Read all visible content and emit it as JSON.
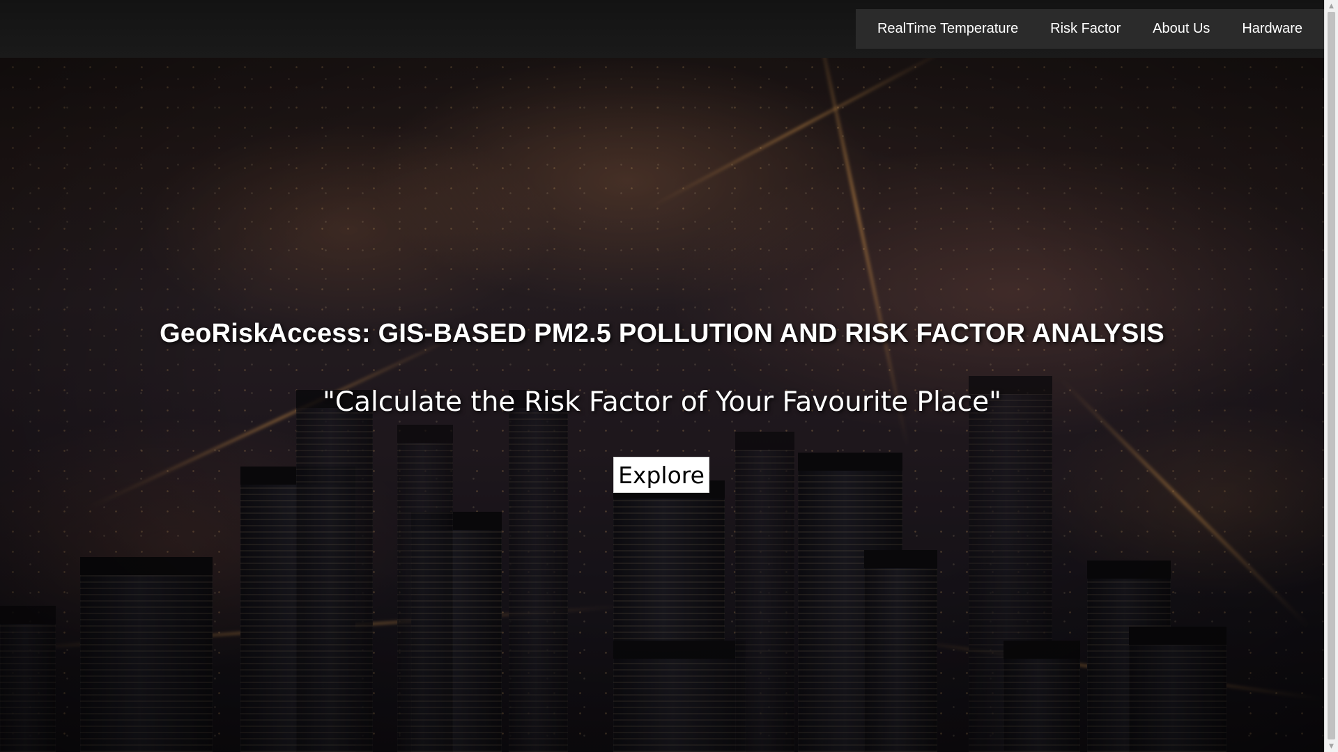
{
  "nav": {
    "items": [
      {
        "label": "RealTime Temperature"
      },
      {
        "label": "Risk Factor"
      },
      {
        "label": "About Us"
      },
      {
        "label": "Hardware"
      }
    ]
  },
  "hero": {
    "title": "GeoRiskAccess: GIS-BASED PM2.5 POLLUTION AND RISK FACTOR ANALYSIS",
    "subtitle": "\"Calculate the Risk Factor of Your Favourite Place\"",
    "button_label": "Explore",
    "background_image": "night city aerial skyline"
  },
  "colors": {
    "topbar": "#151515",
    "nav_background": "#2b2b2b",
    "nav_text": "#ffffff",
    "hero_text": "#ffffff",
    "button_background": "#ffffff",
    "button_text": "#000000"
  },
  "scrollbar": {
    "up_icon": "chevron-up-icon",
    "down_icon": "chevron-down-icon"
  }
}
